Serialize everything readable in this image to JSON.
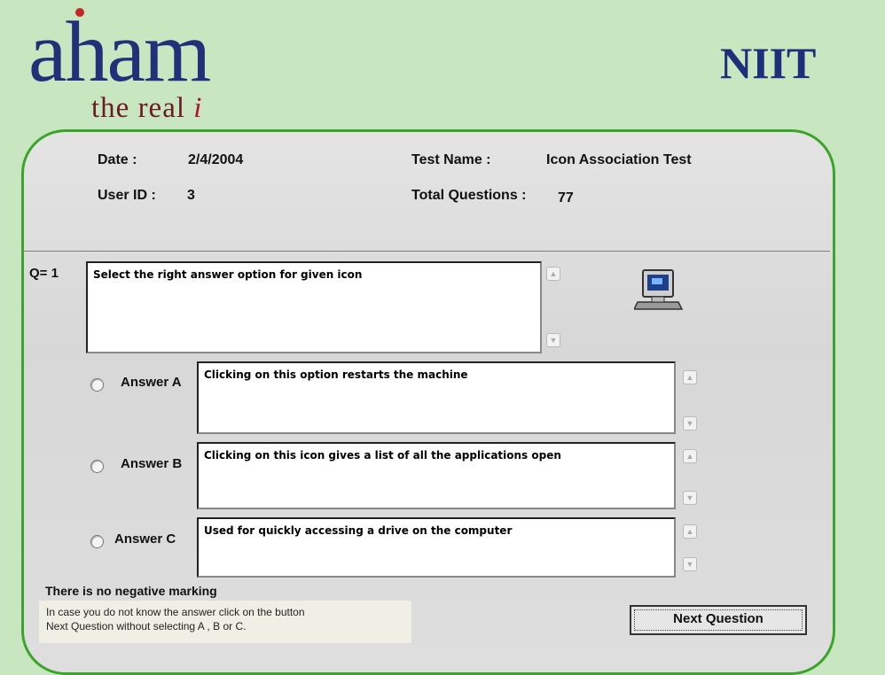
{
  "brand": {
    "logo_text": "aham",
    "tagline_prefix": "the real",
    "tagline_i": "i",
    "company": "NIIT"
  },
  "info": {
    "date_label": "Date :",
    "date_value": "2/4/2004",
    "user_label": "User ID :",
    "user_value": "3",
    "test_label": "Test Name :",
    "test_value": "Icon Association Test",
    "total_label": "Total Questions :",
    "total_value": "77"
  },
  "question": {
    "label": "Q= 1",
    "text": "Select the right answer option for given icon",
    "icon_name": "computer-icon"
  },
  "answers": [
    {
      "label": "Answer A",
      "text": "Clicking on this option restarts the machine"
    },
    {
      "label": "Answer B",
      "text": "Clicking on this icon gives a list of all the applications open"
    },
    {
      "label": "Answer C",
      "text": "Used for quickly accessing a drive on the computer"
    }
  ],
  "notes": {
    "title": "There is no negative marking",
    "line1": "In case you do not know the answer click on the button",
    "line2": "Next Question without selecting A , B or C."
  },
  "buttons": {
    "next": "Next Question"
  },
  "colors": {
    "background": "#c8e6c0",
    "panel_border": "#3aa52a",
    "logo": "#22307a",
    "tagline": "#6c1a24"
  }
}
